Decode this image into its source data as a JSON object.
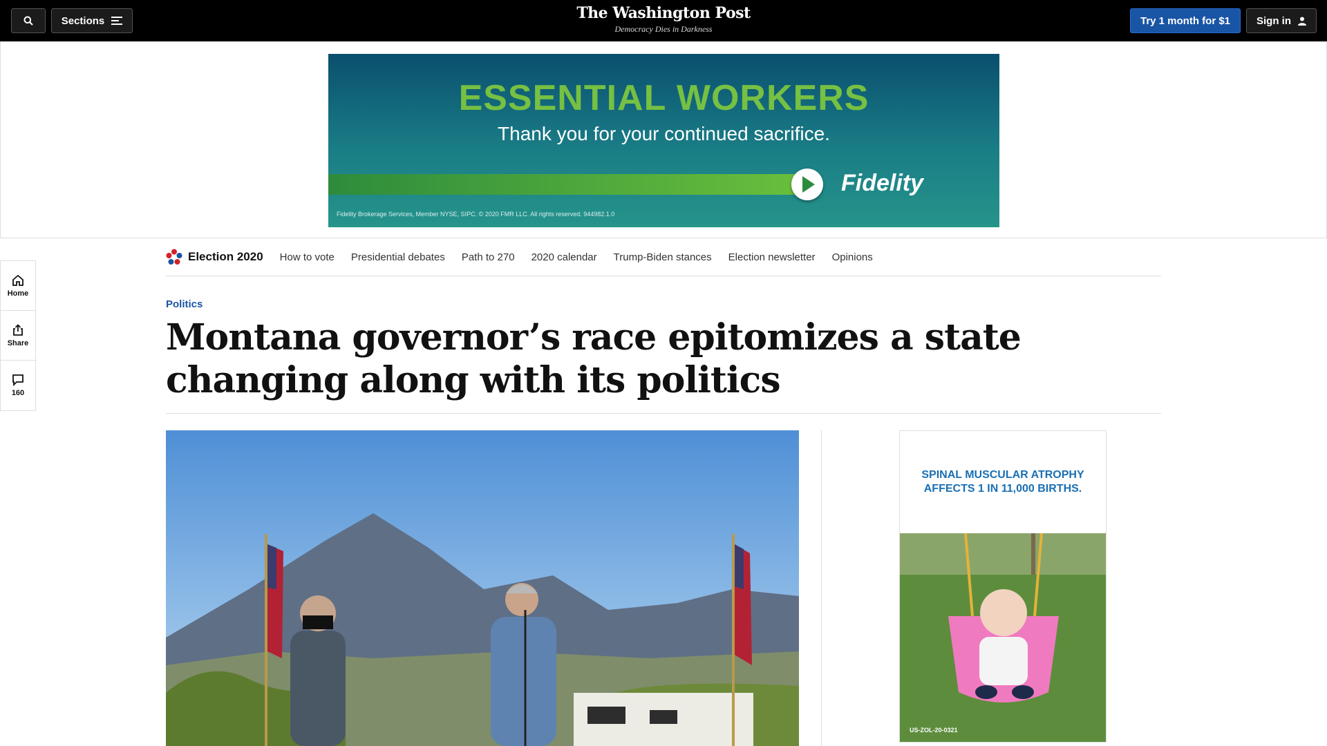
{
  "topbar": {
    "sections_label": "Sections",
    "logo": "The Washington Post",
    "tagline": "Democracy Dies in Darkness",
    "try_label": "Try 1 month for $1",
    "signin_label": "Sign in"
  },
  "top_ad": {
    "headline": "ESSENTIAL WORKERS",
    "subline": "Thank you for your continued sacrifice.",
    "brand": "Fidelity",
    "fine_print": "Fidelity Brokerage Services, Member NYSE, SIPC. © 2020 FMR LLC. All rights reserved. 944982.1.0"
  },
  "election_nav": {
    "title": "Election 2020",
    "links": [
      "How to vote",
      "Presidential debates",
      "Path to 270",
      "2020 calendar",
      "Trump-Biden stances",
      "Election newsletter",
      "Opinions"
    ]
  },
  "rail": {
    "home_label": "Home",
    "share_label": "Share",
    "comments_count": "160"
  },
  "article": {
    "kicker": "Politics",
    "headline": "Montana governor’s race epitomizes a state changing along with its politics"
  },
  "side_ad": {
    "text": "SPINAL MUSCULAR ATROPHY AFFECTS 1 IN 11,000 BIRTHS.",
    "code": "US-ZOL-20-0321"
  },
  "colors": {
    "topbar_bg": "#000000",
    "accent_blue": "#1955a5",
    "ad_green": "#76c043"
  }
}
